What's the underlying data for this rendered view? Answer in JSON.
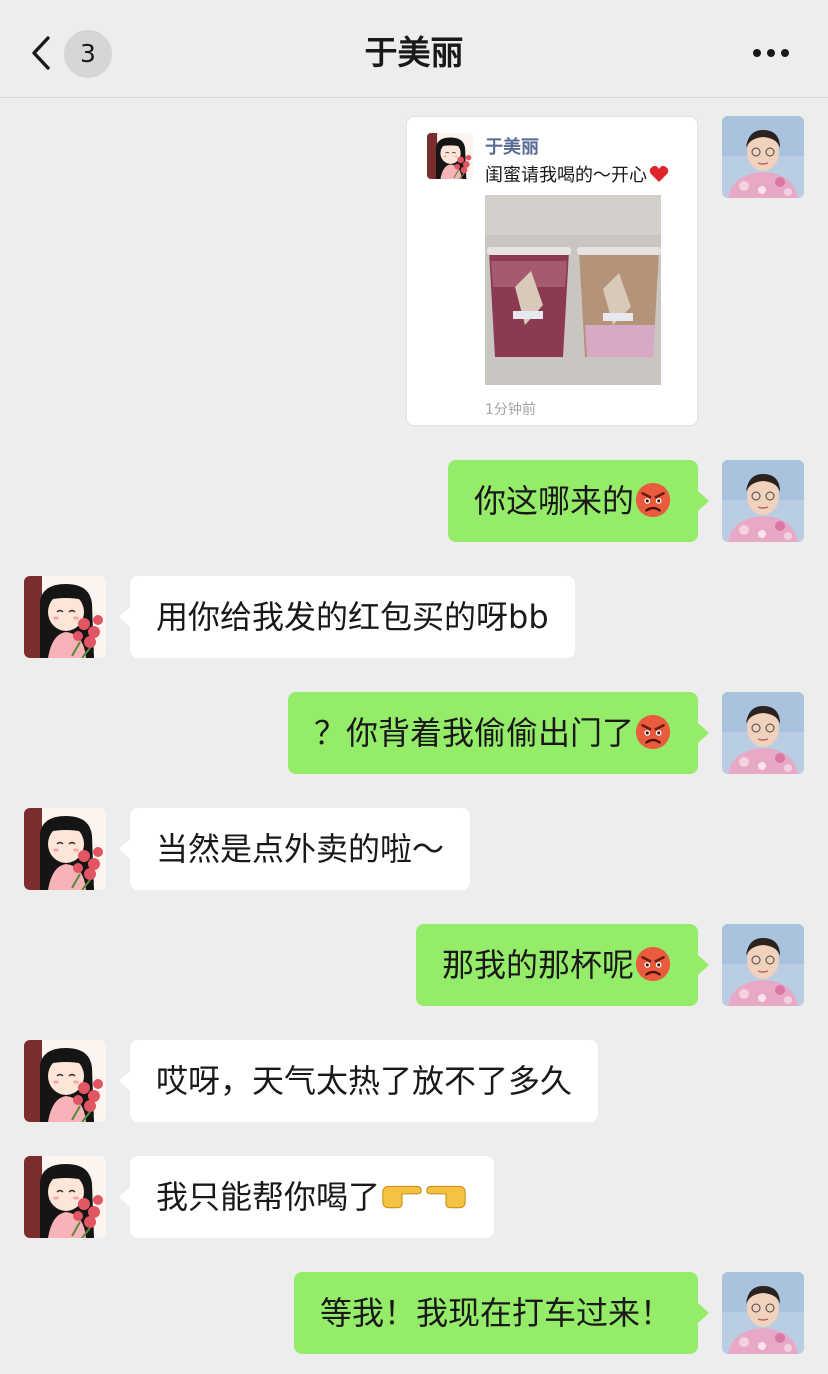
{
  "header": {
    "title": "于美丽",
    "unread_count": "3"
  },
  "moment_card": {
    "author": "于美丽",
    "text": "闺蜜请我喝的～开心",
    "time": "1分钟前"
  },
  "messages": [
    {
      "from": "self",
      "text": "你这哪来的",
      "emoji": "angry-face"
    },
    {
      "from": "peer",
      "text": "用你给我发的红包买的呀bb"
    },
    {
      "from": "self",
      "text": "？你背着我偷偷出门了",
      "emoji": "angry-face"
    },
    {
      "from": "peer",
      "text": "当然是点外卖的啦～"
    },
    {
      "from": "self",
      "text": "那我的那杯呢",
      "emoji": "angry-face"
    },
    {
      "from": "peer",
      "text": "哎呀，天气太热了放不了多久"
    },
    {
      "from": "peer",
      "text": "我只能帮你喝了",
      "emoji": "pointing-hands"
    },
    {
      "from": "self",
      "text": "等我！我现在打车过来！"
    }
  ],
  "colors": {
    "background": "#ededed",
    "outgoing_bubble": "#95ec69",
    "incoming_bubble": "#ffffff",
    "link_name": "#576b95"
  }
}
